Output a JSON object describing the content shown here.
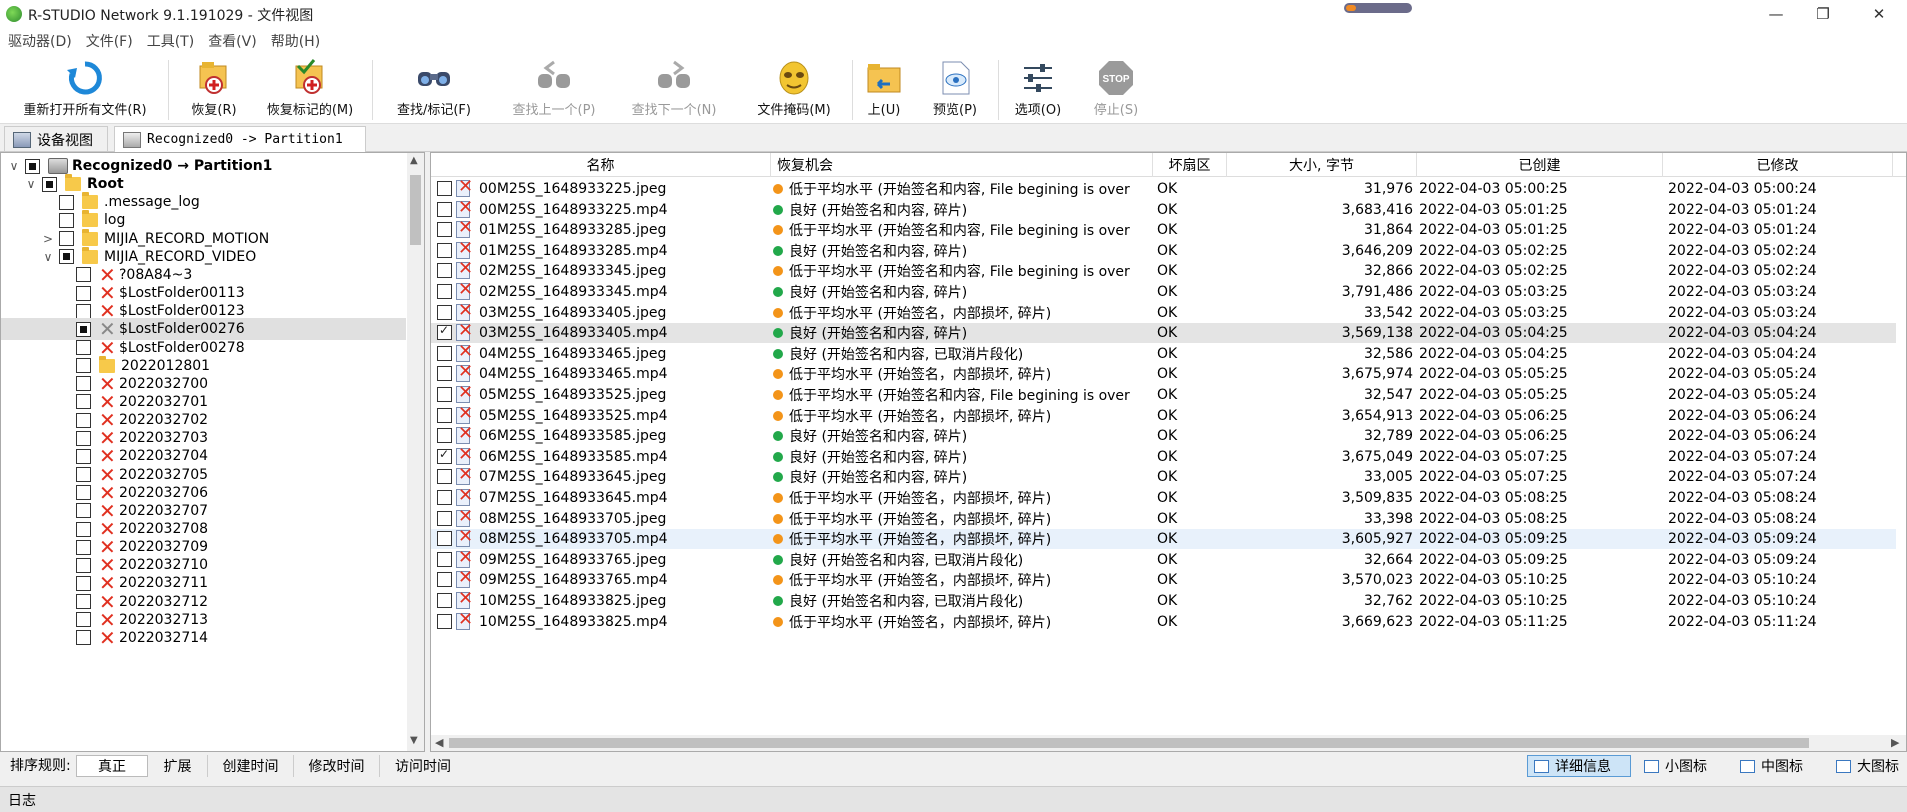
{
  "window": {
    "title": "R-STUDIO Network 9.1.191029 - 文件视图",
    "progress_fraction": 0.15
  },
  "menu": [
    "驱动器(D)",
    "文件(F)",
    "工具(T)",
    "查看(V)",
    "帮助(H)"
  ],
  "toolbar": {
    "reopen": "重新打开所有文件(R)",
    "recover": "恢复(R)",
    "recover_marked": "恢复标记的(M)",
    "find_mark": "查找/标记(F)",
    "find_prev": "查找上一个(P)",
    "find_next": "查找下一个(N)",
    "file_mask": "文件掩码(M)",
    "up": "上(U)",
    "preview": "预览(P)",
    "options": "选项(O)",
    "stop": "停止(S)",
    "stop_icon_text": "STOP"
  },
  "tabs": [
    "设备视图",
    "Recognized0 -> Partition1"
  ],
  "tree": [
    {
      "label": "Recognized0 → Partition1",
      "level": 0,
      "exp": "∨",
      "check": "part",
      "icon": "disk",
      "bold": true
    },
    {
      "label": "Root",
      "level": 1,
      "exp": "∨",
      "check": "part",
      "icon": "folder",
      "bold": true
    },
    {
      "label": ".message_log",
      "level": 2,
      "exp": "",
      "check": "",
      "icon": "folder"
    },
    {
      "label": "log",
      "level": 2,
      "exp": "",
      "check": "",
      "icon": "folder"
    },
    {
      "label": "MIJIA_RECORD_MOTION",
      "level": 2,
      "exp": ">",
      "check": "",
      "icon": "folder"
    },
    {
      "label": "MIJIA_RECORD_VIDEO",
      "level": 2,
      "exp": "∨",
      "check": "part",
      "icon": "folder"
    },
    {
      "label": "?08A84~3",
      "level": 3,
      "exp": "",
      "check": "",
      "icon": "x"
    },
    {
      "label": "$LostFolder00113",
      "level": 3,
      "exp": "",
      "check": "",
      "icon": "x"
    },
    {
      "label": "$LostFolder00123",
      "level": 3,
      "exp": "",
      "check": "",
      "icon": "x"
    },
    {
      "label": "$LostFolder00276",
      "level": 3,
      "exp": "",
      "check": "part",
      "icon": "xgrey",
      "selected": true
    },
    {
      "label": "$LostFolder00278",
      "level": 3,
      "exp": "",
      "check": "",
      "icon": "x"
    },
    {
      "label": "2022012801",
      "level": 3,
      "exp": "",
      "check": "",
      "icon": "folder"
    },
    {
      "label": "2022032700",
      "level": 3,
      "exp": "",
      "check": "",
      "icon": "x"
    },
    {
      "label": "2022032701",
      "level": 3,
      "exp": "",
      "check": "",
      "icon": "x"
    },
    {
      "label": "2022032702",
      "level": 3,
      "exp": "",
      "check": "",
      "icon": "x"
    },
    {
      "label": "2022032703",
      "level": 3,
      "exp": "",
      "check": "",
      "icon": "x"
    },
    {
      "label": "2022032704",
      "level": 3,
      "exp": "",
      "check": "",
      "icon": "x"
    },
    {
      "label": "2022032705",
      "level": 3,
      "exp": "",
      "check": "",
      "icon": "x"
    },
    {
      "label": "2022032706",
      "level": 3,
      "exp": "",
      "check": "",
      "icon": "x"
    },
    {
      "label": "2022032707",
      "level": 3,
      "exp": "",
      "check": "",
      "icon": "x"
    },
    {
      "label": "2022032708",
      "level": 3,
      "exp": "",
      "check": "",
      "icon": "x"
    },
    {
      "label": "2022032709",
      "level": 3,
      "exp": "",
      "check": "",
      "icon": "x"
    },
    {
      "label": "2022032710",
      "level": 3,
      "exp": "",
      "check": "",
      "icon": "x"
    },
    {
      "label": "2022032711",
      "level": 3,
      "exp": "",
      "check": "",
      "icon": "x"
    },
    {
      "label": "2022032712",
      "level": 3,
      "exp": "",
      "check": "",
      "icon": "x"
    },
    {
      "label": "2022032713",
      "level": 3,
      "exp": "",
      "check": "",
      "icon": "x"
    },
    {
      "label": "2022032714",
      "level": 3,
      "exp": "",
      "check": "",
      "icon": "x"
    }
  ],
  "list": {
    "columns": [
      "名称",
      "恢复机会",
      "坏扇区",
      "大小, 字节",
      "已创建",
      "已修改"
    ],
    "rows": [
      {
        "name": "00M25S_1648933225.jpeg",
        "chance": "低于平均水平 (开始签名和内容, File begining is over",
        "status": "orange",
        "bad": "OK",
        "size": "31,976",
        "created": "2022-04-03 05:00:25",
        "modified": "2022-04-03 05:00:24"
      },
      {
        "name": "00M25S_1648933225.mp4",
        "chance": "良好 (开始签名和内容, 碎片)",
        "status": "green",
        "bad": "OK",
        "size": "3,683,416",
        "created": "2022-04-03 05:01:25",
        "modified": "2022-04-03 05:01:24"
      },
      {
        "name": "01M25S_1648933285.jpeg",
        "chance": "低于平均水平 (开始签名和内容, File begining is over",
        "status": "orange",
        "bad": "OK",
        "size": "31,864",
        "created": "2022-04-03 05:01:25",
        "modified": "2022-04-03 05:01:24"
      },
      {
        "name": "01M25S_1648933285.mp4",
        "chance": "良好 (开始签名和内容, 碎片)",
        "status": "green",
        "bad": "OK",
        "size": "3,646,209",
        "created": "2022-04-03 05:02:25",
        "modified": "2022-04-03 05:02:24"
      },
      {
        "name": "02M25S_1648933345.jpeg",
        "chance": "低于平均水平 (开始签名和内容, File begining is over",
        "status": "orange",
        "bad": "OK",
        "size": "32,866",
        "created": "2022-04-03 05:02:25",
        "modified": "2022-04-03 05:02:24"
      },
      {
        "name": "02M25S_1648933345.mp4",
        "chance": "良好 (开始签名和内容, 碎片)",
        "status": "green",
        "bad": "OK",
        "size": "3,791,486",
        "created": "2022-04-03 05:03:25",
        "modified": "2022-04-03 05:03:24"
      },
      {
        "name": "03M25S_1648933405.jpeg",
        "chance": "低于平均水平 (开始签名，内部损坏, 碎片)",
        "status": "orange",
        "bad": "OK",
        "size": "33,542",
        "created": "2022-04-03 05:03:25",
        "modified": "2022-04-03 05:03:24"
      },
      {
        "name": "03M25S_1648933405.mp4",
        "chance": "良好 (开始签名和内容, 碎片)",
        "status": "green",
        "bad": "OK",
        "size": "3,569,138",
        "created": "2022-04-03 05:04:25",
        "modified": "2022-04-03 05:04:24",
        "checked": true,
        "selected": true
      },
      {
        "name": "04M25S_1648933465.jpeg",
        "chance": "良好 (开始签名和内容, 已取消片段化)",
        "status": "green",
        "bad": "OK",
        "size": "32,586",
        "created": "2022-04-03 05:04:25",
        "modified": "2022-04-03 05:04:24"
      },
      {
        "name": "04M25S_1648933465.mp4",
        "chance": "低于平均水平 (开始签名，内部损坏, 碎片)",
        "status": "orange",
        "bad": "OK",
        "size": "3,675,974",
        "created": "2022-04-03 05:05:25",
        "modified": "2022-04-03 05:05:24"
      },
      {
        "name": "05M25S_1648933525.jpeg",
        "chance": "低于平均水平 (开始签名和内容, File begining is over",
        "status": "orange",
        "bad": "OK",
        "size": "32,547",
        "created": "2022-04-03 05:05:25",
        "modified": "2022-04-03 05:05:24"
      },
      {
        "name": "05M25S_1648933525.mp4",
        "chance": "低于平均水平 (开始签名，内部损坏, 碎片)",
        "status": "orange",
        "bad": "OK",
        "size": "3,654,913",
        "created": "2022-04-03 05:06:25",
        "modified": "2022-04-03 05:06:24"
      },
      {
        "name": "06M25S_1648933585.jpeg",
        "chance": "良好 (开始签名和内容, 碎片)",
        "status": "green",
        "bad": "OK",
        "size": "32,789",
        "created": "2022-04-03 05:06:25",
        "modified": "2022-04-03 05:06:24"
      },
      {
        "name": "06M25S_1648933585.mp4",
        "chance": "良好 (开始签名和内容, 碎片)",
        "status": "green",
        "bad": "OK",
        "size": "3,675,049",
        "created": "2022-04-03 05:07:25",
        "modified": "2022-04-03 05:07:24",
        "checked": true
      },
      {
        "name": "07M25S_1648933645.jpeg",
        "chance": "良好 (开始签名和内容, 碎片)",
        "status": "green",
        "bad": "OK",
        "size": "33,005",
        "created": "2022-04-03 05:07:25",
        "modified": "2022-04-03 05:07:24"
      },
      {
        "name": "07M25S_1648933645.mp4",
        "chance": "低于平均水平 (开始签名，内部损坏, 碎片)",
        "status": "orange",
        "bad": "OK",
        "size": "3,509,835",
        "created": "2022-04-03 05:08:25",
        "modified": "2022-04-03 05:08:24"
      },
      {
        "name": "08M25S_1648933705.jpeg",
        "chance": "低于平均水平 (开始签名，内部损坏, 碎片)",
        "status": "orange",
        "bad": "OK",
        "size": "33,398",
        "created": "2022-04-03 05:08:25",
        "modified": "2022-04-03 05:08:24"
      },
      {
        "name": "08M25S_1648933705.mp4",
        "chance": "低于平均水平 (开始签名，内部损坏, 碎片)",
        "status": "orange",
        "bad": "OK",
        "size": "3,605,927",
        "created": "2022-04-03 05:09:25",
        "modified": "2022-04-03 05:09:24",
        "hover": true
      },
      {
        "name": "09M25S_1648933765.jpeg",
        "chance": "良好 (开始签名和内容, 已取消片段化)",
        "status": "green",
        "bad": "OK",
        "size": "32,664",
        "created": "2022-04-03 05:09:25",
        "modified": "2022-04-03 05:09:24"
      },
      {
        "name": "09M25S_1648933765.mp4",
        "chance": "低于平均水平 (开始签名，内部损坏, 碎片)",
        "status": "orange",
        "bad": "OK",
        "size": "3,570,023",
        "created": "2022-04-03 05:10:25",
        "modified": "2022-04-03 05:10:24"
      },
      {
        "name": "10M25S_1648933825.jpeg",
        "chance": "良好 (开始签名和内容, 已取消片段化)",
        "status": "green",
        "bad": "OK",
        "size": "32,762",
        "created": "2022-04-03 05:10:25",
        "modified": "2022-04-03 05:10:24"
      },
      {
        "name": "10M25S_1648933825.mp4",
        "chance": "低于平均水平 (开始签名，内部损坏, 碎片)",
        "status": "orange",
        "bad": "OK",
        "size": "3,669,623",
        "created": "2022-04-03 05:11:25",
        "modified": "2022-04-03 05:11:24"
      }
    ]
  },
  "status_colors": {
    "green": "#22a84a",
    "orange": "#f39419"
  },
  "sort": {
    "label": "排序规则:",
    "options": [
      "真正",
      "扩展",
      "创建时间",
      "修改时间",
      "访问时间"
    ]
  },
  "views": [
    "详细信息",
    "小图标",
    "中图标",
    "大图标"
  ],
  "statusbar": {
    "log": "日志"
  }
}
